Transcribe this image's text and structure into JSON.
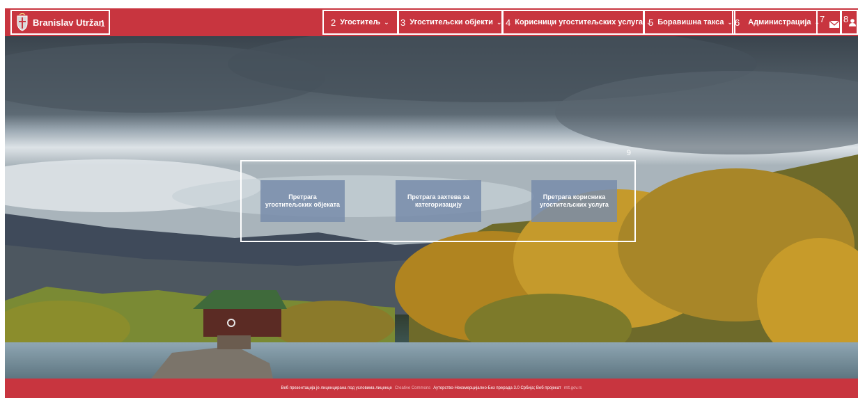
{
  "header": {
    "user_name": "Branislav Utržan",
    "annotations": [
      "1",
      "2",
      "3",
      "4",
      "5",
      "6",
      "7",
      "8"
    ],
    "nav": [
      {
        "label": "Угоститељ"
      },
      {
        "label": "Угоститељски објекти"
      },
      {
        "label": "Корисници угоститељских услуга"
      },
      {
        "label": "Боравишна такса"
      },
      {
        "label": "Администрација"
      }
    ],
    "icons": [
      "mail-icon",
      "user-icon"
    ]
  },
  "search": {
    "annotation": "9",
    "buttons": [
      {
        "label": "Претрага угоститељских објеката"
      },
      {
        "label": "Претрага захтева за категоризацију"
      },
      {
        "label": "Претрага корисника угоститељских услуга"
      }
    ]
  },
  "footer": {
    "text1": "Веб презентација је лиценцирана под условима лиценце",
    "link1": "Creative Commons",
    "text2": "Ауторство-Некомерцијално-Без прерада 3.0 Србија; Веб пројекат",
    "link2": "mtt.gov.rs"
  },
  "colors": {
    "brand_red": "#c8353f"
  }
}
